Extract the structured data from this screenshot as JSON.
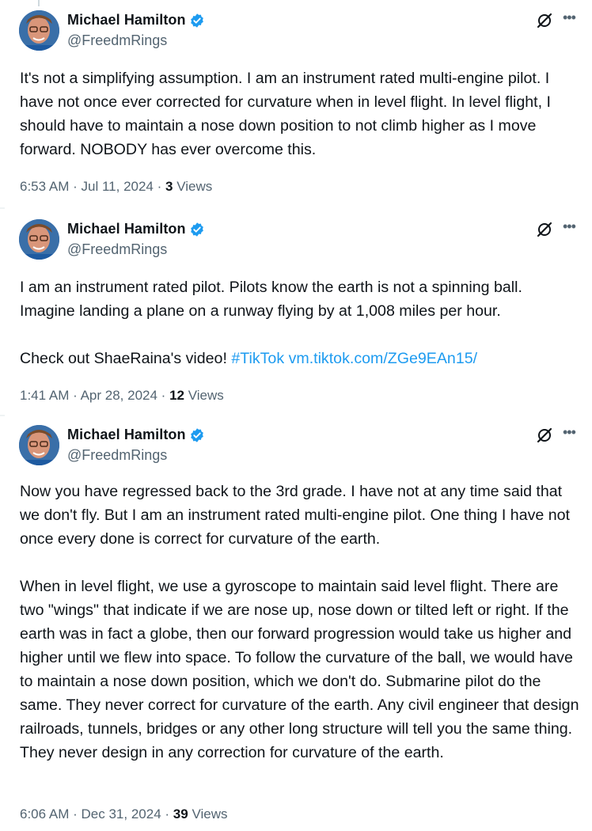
{
  "tweets": [
    {
      "author": {
        "name": "Michael Hamilton",
        "handle": "@FreedmRings"
      },
      "text": "It's not a simplifying assumption. I am an instrument rated multi-engine pilot. I have not once ever corrected for curvature when in level flight. In level flight, I should have to maintain a nose down position to not climb higher as I move forward. NOBODY has ever overcome this.",
      "time": "6:53 AM",
      "date": "Jul 11, 2024",
      "views_count": "3",
      "views_label": "Views"
    },
    {
      "author": {
        "name": "Michael Hamilton",
        "handle": "@FreedmRings"
      },
      "text": "I am an instrument rated pilot. Pilots know the earth is not a spinning ball. Imagine landing a plane on a runway flying by at 1,008 miles per hour.\n\nCheck out ShaeRaina's video! ",
      "hashtag": "#TikTok",
      "url": "vm.tiktok.com/ZGe9EAn15/",
      "time": "1:41 AM",
      "date": "Apr 28, 2024",
      "views_count": "12",
      "views_label": "Views"
    },
    {
      "author": {
        "name": "Michael Hamilton",
        "handle": "@FreedmRings"
      },
      "text": "Now you have regressed back to the 3rd grade. I have not at any time said that we don't fly. But I am an instrument rated multi-engine pilot. One thing I have not once every done is correct for curvature of the earth.\n\nWhen in level flight, we use a gyroscope to maintain said level flight. There are two \"wings\" that indicate if we are nose up, nose down or tilted left or right. If the earth was in fact a globe, then our forward progression would take us higher and higher until we flew into space. To follow the curvature of the ball, we would have to maintain a nose down position, which we don't do. Submarine pilot do the same. They never correct for curvature of the earth. Any civil engineer that design railroads, tunnels, bridges or any other long structure will tell you the same thing. They never design in any correction for curvature of the earth.",
      "time": "6:06 AM",
      "date": "Dec 31, 2024",
      "views_count": "39",
      "views_label": "Views"
    }
  ],
  "meta_separator": "·",
  "icons": {
    "verified": "verified-badge-icon",
    "grok": "grok-icon",
    "more": "more-icon"
  },
  "colors": {
    "link": "#1d9bf0",
    "secondary": "#536471",
    "verified": "#1d9bf0"
  }
}
